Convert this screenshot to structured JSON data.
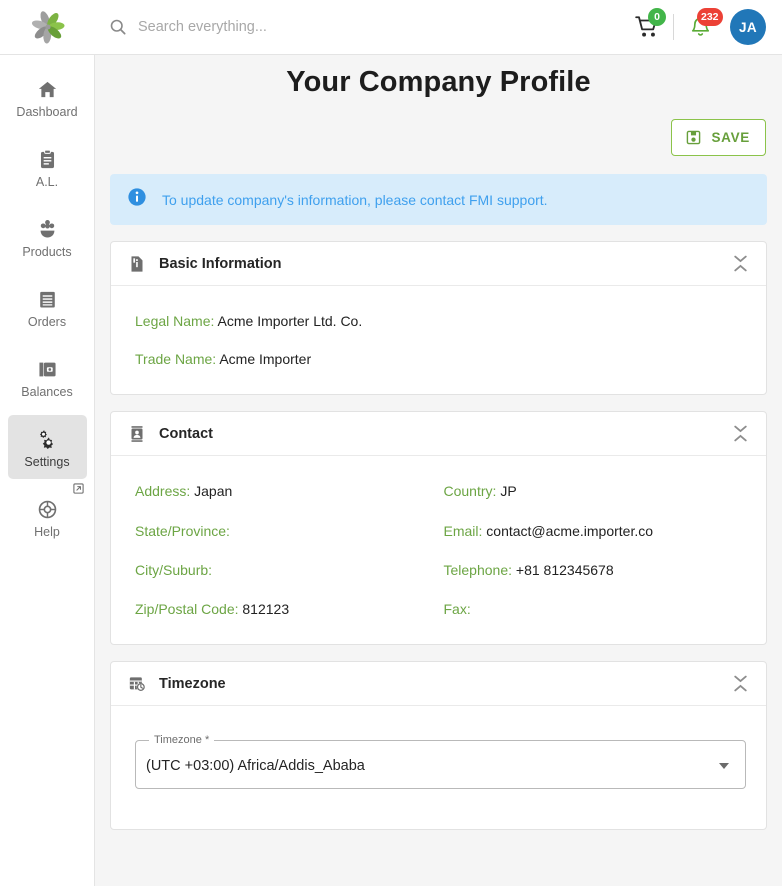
{
  "topbar": {
    "logo_name": "company-logo",
    "search": {
      "placeholder": "Search everything...",
      "value": ""
    },
    "cart": {
      "icon": "cart-icon",
      "badge": "0",
      "badge_color": "#42b549"
    },
    "notifications": {
      "icon": "bell-icon",
      "badge": "232",
      "badge_color": "#ec4136"
    },
    "avatar": {
      "initials": "JA",
      "color": "#2177b8"
    }
  },
  "sidebar": {
    "items": [
      {
        "label": "Dashboard",
        "icon": "home-icon",
        "active": false
      },
      {
        "label": "A.L.",
        "icon": "clipboard-icon",
        "active": false
      },
      {
        "label": "Products",
        "icon": "flower-product-icon",
        "active": false
      },
      {
        "label": "Orders",
        "icon": "receipt-icon",
        "active": false
      },
      {
        "label": "Balances",
        "icon": "wallet-icon",
        "active": false
      },
      {
        "label": "Settings",
        "icon": "gears-icon",
        "active": true
      },
      {
        "label": "Help",
        "icon": "lifebuoy-icon",
        "active": false,
        "external": true
      }
    ]
  },
  "main": {
    "title": "Your Company Profile",
    "save_button": {
      "label": "SAVE",
      "icon": "save-disk-icon",
      "color": "#679f3b"
    },
    "alert": {
      "icon": "info-circle-icon",
      "text": "To update company's information, please contact FMI support.",
      "bg": "#d7ecfb",
      "text_color": "#3fa0ee"
    },
    "cards": [
      {
        "id": "basic-information",
        "title": "Basic Information",
        "icon": "document-info-icon",
        "fields": [
          {
            "label": "Legal Name:",
            "value": "Acme Importer Ltd. Co."
          },
          {
            "label": "Trade Name:",
            "value": "Acme Importer"
          }
        ]
      },
      {
        "id": "contact",
        "title": "Contact",
        "icon": "contact-card-icon",
        "fields": [
          {
            "label": "Address:",
            "value": "Japan"
          },
          {
            "label": "Country:",
            "value": "JP"
          },
          {
            "label": "State/Province:",
            "value": ""
          },
          {
            "label": "Email:",
            "value": "contact@acme.importer.co"
          },
          {
            "label": "City/Suburb:",
            "value": ""
          },
          {
            "label": "Telephone:",
            "value": "+81 812345678"
          },
          {
            "label": "Zip/Postal Code:",
            "value": "812123"
          },
          {
            "label": "Fax:",
            "value": ""
          }
        ]
      },
      {
        "id": "timezone",
        "title": "Timezone",
        "icon": "calendar-clock-icon",
        "select": {
          "legend": "Timezone *",
          "value": "(UTC +03:00) Africa/Addis_Ababa"
        }
      }
    ]
  },
  "colors": {
    "label_green": "#6ca544",
    "accent_green": "#8bc34a",
    "page_bg": "#f5f5f5"
  }
}
